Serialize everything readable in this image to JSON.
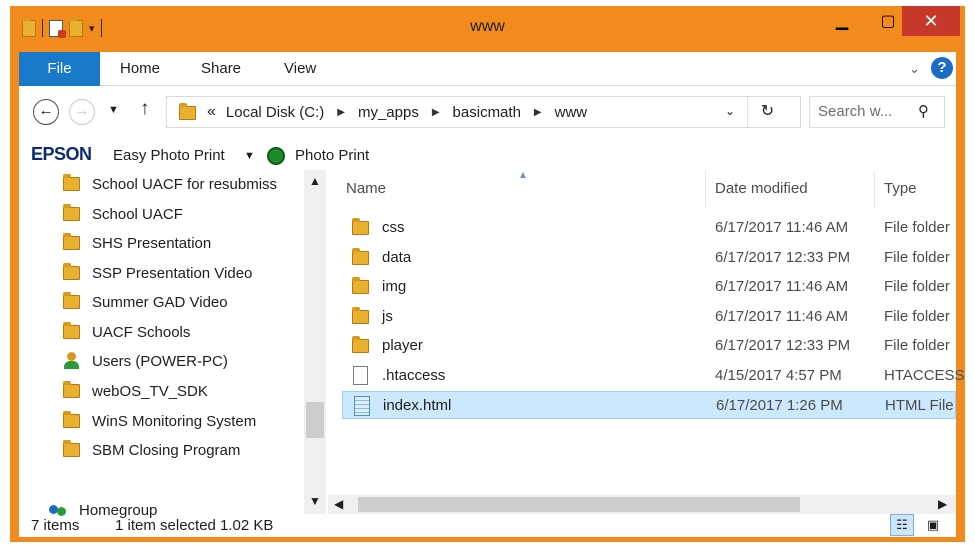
{
  "window": {
    "title": "www"
  },
  "ribbon": {
    "tabs": [
      "File",
      "Home",
      "Share",
      "View"
    ]
  },
  "address": {
    "breadcrumb": [
      "Local Disk (C:)",
      "my_apps",
      "basicmath",
      "www"
    ],
    "overflow_marker": "«"
  },
  "search": {
    "placeholder": "Search w..."
  },
  "epson_toolbar": {
    "logo": "EPSON",
    "easy_photo_print": "Easy Photo Print",
    "photo_print": "Photo Print"
  },
  "nav_pane": {
    "items": [
      {
        "label": "School UACF for resubmiss",
        "icon": "folder-icon"
      },
      {
        "label": "School UACF",
        "icon": "folder-icon"
      },
      {
        "label": "SHS Presentation",
        "icon": "folder-icon"
      },
      {
        "label": "SSP Presentation Video",
        "icon": "folder-icon"
      },
      {
        "label": "Summer GAD Video",
        "icon": "folder-icon"
      },
      {
        "label": "UACF Schools",
        "icon": "folder-icon"
      },
      {
        "label": "Users (POWER-PC)",
        "icon": "network-user-icon"
      },
      {
        "label": "webOS_TV_SDK",
        "icon": "folder-icon"
      },
      {
        "label": "WinS Monitoring System",
        "icon": "folder-icon"
      },
      {
        "label": "SBM Closing Program",
        "icon": "folder-icon"
      }
    ],
    "homegroup": "Homegroup"
  },
  "file_list": {
    "columns": {
      "name": "Name",
      "date": "Date modified",
      "type": "Type"
    },
    "rows": [
      {
        "name": "css",
        "date": "6/17/2017 11:46 AM",
        "type": "File folder",
        "icon": "folder-icon",
        "selected": false
      },
      {
        "name": "data",
        "date": "6/17/2017 12:33 PM",
        "type": "File folder",
        "icon": "folder-icon",
        "selected": false
      },
      {
        "name": "img",
        "date": "6/17/2017 11:46 AM",
        "type": "File folder",
        "icon": "folder-icon",
        "selected": false
      },
      {
        "name": "js",
        "date": "6/17/2017 11:46 AM",
        "type": "File folder",
        "icon": "folder-icon",
        "selected": false
      },
      {
        "name": "player",
        "date": "6/17/2017 12:33 PM",
        "type": "File folder",
        "icon": "folder-icon",
        "selected": false
      },
      {
        "name": ".htaccess",
        "date": "4/15/2017 4:57 PM",
        "type": "HTACCESS",
        "icon": "file-icon",
        "selected": false
      },
      {
        "name": "index.html",
        "date": "6/17/2017 1:26 PM",
        "type": "HTML File",
        "icon": "html-file-icon",
        "selected": true
      }
    ]
  },
  "status": {
    "item_count": "7 items",
    "selection": "1 item selected  1.02 KB"
  },
  "colors": {
    "window_frame": "#f28b1e",
    "file_tab": "#1979ca",
    "close_button": "#c7382a",
    "selection": "#cce8ff"
  }
}
